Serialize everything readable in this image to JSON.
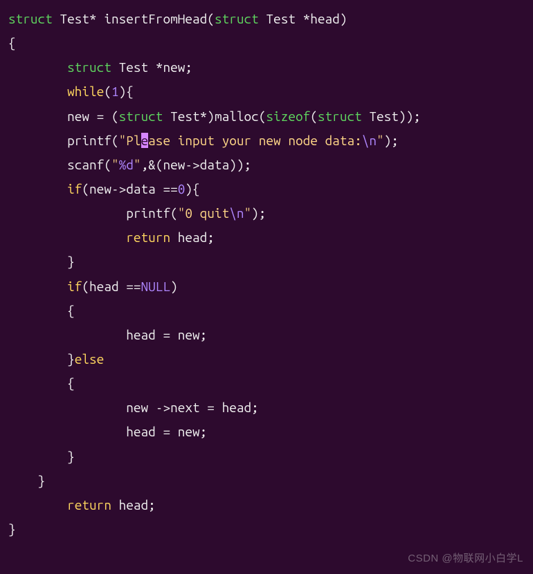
{
  "code": {
    "struct_kw": "struct",
    "test_type": "Test",
    "star": "*",
    "func_name": "insertFromHead",
    "head_param": "head",
    "new_var": "new",
    "while_kw": "while",
    "one": "1",
    "malloc_fn": "malloc",
    "sizeof_kw": "sizeof",
    "printf_fn": "printf",
    "scanf_fn": "scanf",
    "str_prefix": "\"Pl",
    "cursor_char": "e",
    "str_mid": "ase input your new node data:",
    "esc_n": "\\n",
    "quote_close": "\"",
    "percent_d": "%d",
    "scanf_str_open": "\"",
    "scanf_str_close": "\"",
    "amp": "&",
    "new_data": "new->data",
    "if_kw": "if",
    "zero": "0",
    "quit_str": "\"0 quit",
    "return_kw": "return",
    "null_kw": "NULL",
    "else_kw": "else",
    "next_field": "new ->next = head;",
    "head_eq_new": "head = new;",
    "watermark": "CSDN @物联网小白学L"
  }
}
